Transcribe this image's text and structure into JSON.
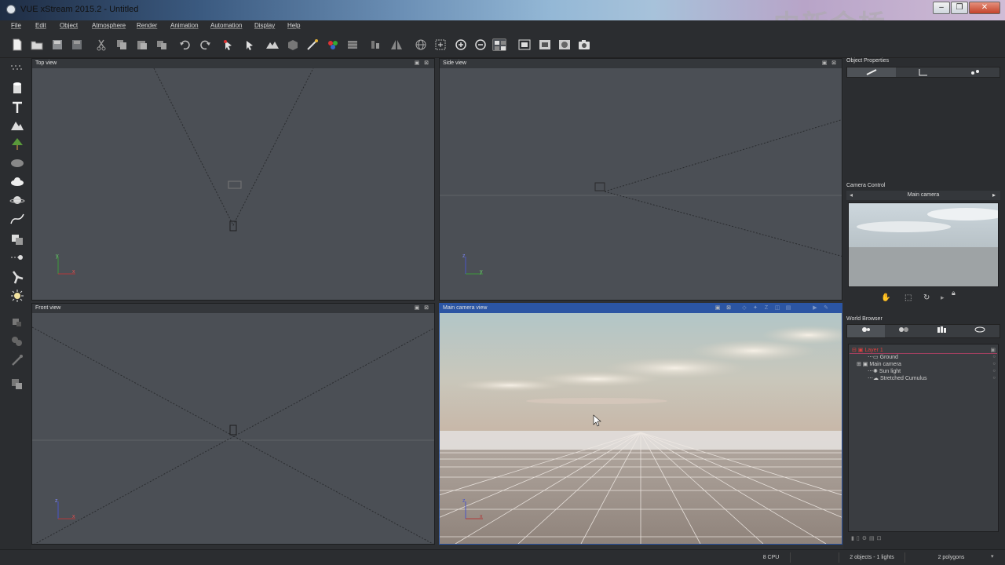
{
  "window": {
    "title": "VUE xStream 2015.2 - Untitled",
    "watermark": "中新金桥",
    "controls": [
      "–",
      "❐",
      "✕"
    ]
  },
  "menu": [
    "File",
    "Edit",
    "Object",
    "Atmosphere",
    "Render",
    "Animation",
    "Automation",
    "Display",
    "Help"
  ],
  "toolbar": {
    "icons": [
      "new-file-icon",
      "open-file-icon",
      "save-icon",
      "save-as-icon",
      "cut-icon",
      "copy-icon",
      "paste-icon",
      "duplicate-icon",
      "undo-icon",
      "redo-icon",
      "select-icon",
      "pointer-icon",
      "terrain-icon",
      "object-library-icon",
      "wand-icon",
      "material-icon",
      "film-icon",
      "align-icon",
      "symmetry-icon",
      "globe-icon",
      "frame-icon",
      "zoom-in-icon",
      "zoom-out-icon",
      "layout-icon",
      "render-area-icon",
      "render-icon",
      "render-sphere-icon",
      "camera-icon"
    ]
  },
  "left_tools": [
    "stars-icon",
    "cylinder-icon",
    "text-icon",
    "terrain-icon",
    "tree-icon",
    "rock-icon",
    "cloud-icon",
    "planet-icon",
    "curve-icon",
    "boolean-icon",
    "spline-icon",
    "fan-icon",
    "sun-icon",
    "scatter-icon",
    "metablob-icon",
    "link-icon",
    "group-icon"
  ],
  "viewports": {
    "top": {
      "title": "Top view"
    },
    "side": {
      "title": "Side view"
    },
    "front": {
      "title": "Front view"
    },
    "camera": {
      "title": "Main camera view"
    }
  },
  "axes": {
    "x": "x",
    "y": "y",
    "z": "z"
  },
  "object_properties": {
    "title": "Object Properties"
  },
  "camera_control": {
    "title": "Camera Control",
    "camera_name": "Main camera"
  },
  "world_browser": {
    "title": "World Browser",
    "layer": "Layer 1",
    "items": [
      "Ground",
      "Main camera",
      "Sun light",
      "Stretched Cumulus"
    ]
  },
  "status": {
    "cpu": "8 CPU",
    "objects": "2 objects - 1 lights",
    "polygons": "2 polygons"
  }
}
